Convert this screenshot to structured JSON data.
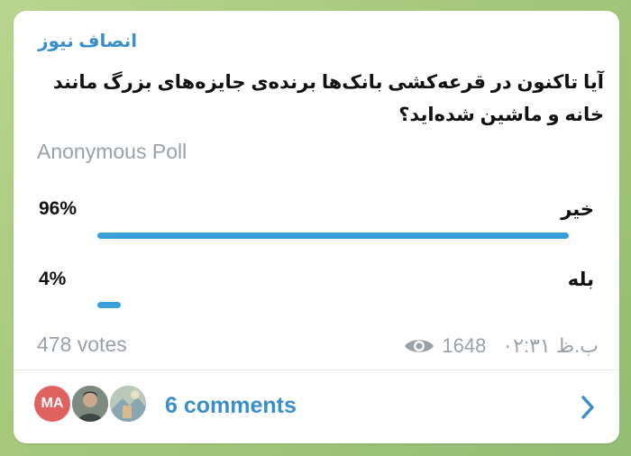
{
  "message": {
    "channel_name": "انصاف نیوز",
    "question": "آیا تاکنون در قرعه‌کشی بانک‌ها برنده‌ی جایزه‌های بزرگ مانند خانه و ماشین شده‌اید؟",
    "poll_type": "Anonymous Poll",
    "options": [
      {
        "label": "خیر",
        "percent": "96%",
        "fraction": 0.96
      },
      {
        "label": "بله",
        "percent": "4%",
        "fraction": 0.04
      }
    ],
    "votes": "478 votes",
    "views": "1648",
    "time": "ب.ظ ۰۲:۳۱"
  },
  "footer": {
    "avatar_initials": "MA",
    "comments_label": "6 comments"
  },
  "colors": {
    "accent": "#3a8ec9",
    "bar": "#3a9ed8",
    "muted": "#9aa1a8",
    "avatar_ma": "#e0625e"
  },
  "icons": [
    "eye-icon",
    "chevron-right-icon"
  ]
}
